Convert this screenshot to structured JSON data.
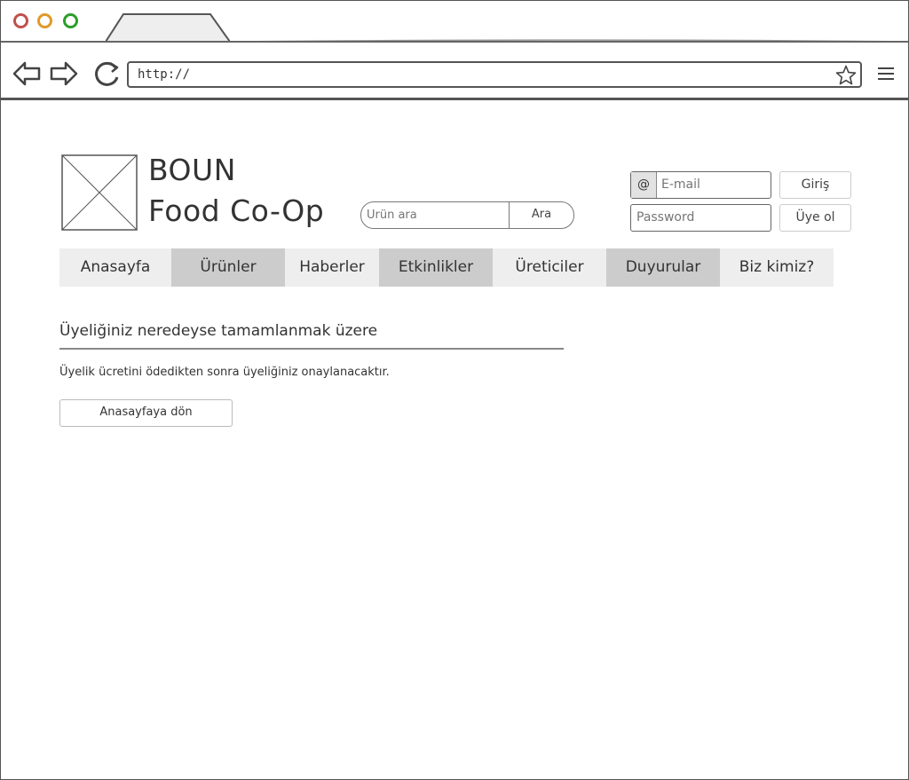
{
  "browser": {
    "url": "http://",
    "colors": {
      "close": "#c0504d",
      "minimize": "#e09a2a",
      "maximize": "#2a9e2a"
    }
  },
  "header": {
    "brand_line1": "BOUN",
    "brand_line2": "Food Co-Op",
    "search": {
      "placeholder": "Ürün ara",
      "button": "Ara"
    },
    "login": {
      "email_icon": "@",
      "email_placeholder": "E-mail",
      "password_placeholder": "Password",
      "login_button": "Giriş",
      "signup_button": "Üye ol"
    }
  },
  "nav": {
    "items": [
      {
        "label": "Anasayfa"
      },
      {
        "label": "Ürünler"
      },
      {
        "label": "Haberler"
      },
      {
        "label": "Etkinlikler"
      },
      {
        "label": "Üreticiler"
      },
      {
        "label": "Duyurular"
      },
      {
        "label": "Biz kimiz?"
      }
    ]
  },
  "main": {
    "heading": "Üyeliğiniz neredeyse tamamlanmak üzere",
    "message": "Üyelik ücretini ödedikten sonra üyeliğiniz onaylanacaktır.",
    "home_button": "Anasayfaya dön"
  }
}
